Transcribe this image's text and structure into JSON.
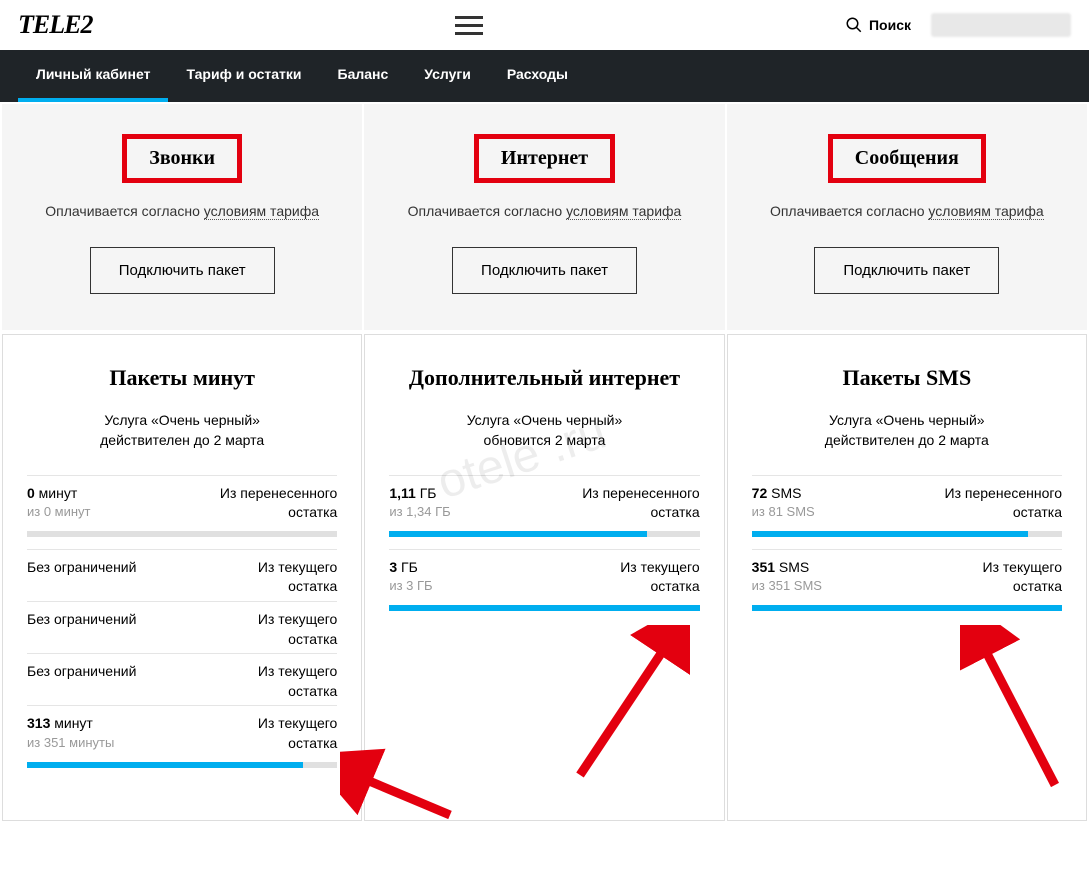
{
  "header": {
    "logo": "TELE2",
    "search_label": "Поиск"
  },
  "nav": {
    "items": [
      "Личный кабинет",
      "Тариф и остатки",
      "Баланс",
      "Услуги",
      "Расходы"
    ]
  },
  "top_cards": [
    {
      "title": "Звонки",
      "sub_prefix": "Оплачивается согласно ",
      "sub_link": "условиям тарифа",
      "button": "Подключить пакет"
    },
    {
      "title": "Интернет",
      "sub_prefix": "Оплачивается согласно ",
      "sub_link": "условиям тарифа",
      "button": "Подключить пакет"
    },
    {
      "title": "Сообщения",
      "sub_prefix": "Оплачивается согласно ",
      "sub_link": "условиям тарифа",
      "button": "Подключить пакет"
    }
  ],
  "bottom_cards": [
    {
      "title": "Пакеты минут",
      "service_line1": "Услуга «Очень черный»",
      "service_line2": "действителен до 2 марта",
      "rows": [
        {
          "left_v1_b": "0",
          "left_v1_u": "минут",
          "left_v2": "из 0 минут",
          "right1": "Из перенесенного",
          "right2": "остатка",
          "bar": 0
        },
        {
          "left_plain": "Без ограничений",
          "right1": "Из текущего",
          "right2": "остатка"
        },
        {
          "left_plain": "Без ограничений",
          "right1": "Из текущего",
          "right2": "остатка"
        },
        {
          "left_plain": "Без ограничений",
          "right1": "Из текущего",
          "right2": "остатка"
        },
        {
          "left_v1_b": "313",
          "left_v1_u": "минут",
          "left_v2": "из 351 минуты",
          "right1": "Из текущего",
          "right2": "остатка",
          "bar": 89
        }
      ]
    },
    {
      "title": "Дополнительный интернет",
      "service_line1": "Услуга «Очень черный»",
      "service_line2": "обновится 2 марта",
      "rows": [
        {
          "left_v1_b": "1,11",
          "left_v1_u": "ГБ",
          "left_v2": "из 1,34 ГБ",
          "right1": "Из перенесенного",
          "right2": "остатка",
          "bar": 83
        },
        {
          "left_v1_b": "3",
          "left_v1_u": "ГБ",
          "left_v2": "из 3 ГБ",
          "right1": "Из текущего",
          "right2": "остатка",
          "bar": 100
        }
      ]
    },
    {
      "title": "Пакеты SMS",
      "service_line1": "Услуга «Очень черный»",
      "service_line2": "действителен до 2 марта",
      "rows": [
        {
          "left_v1_b": "72",
          "left_v1_u": "SMS",
          "left_v2": "из 81 SMS",
          "right1": "Из перенесенного",
          "right2": "остатка",
          "bar": 89
        },
        {
          "left_v1_b": "351",
          "left_v1_u": "SMS",
          "left_v2": "из 351 SMS",
          "right1": "Из текущего",
          "right2": "остатка",
          "bar": 100
        }
      ]
    }
  ],
  "watermark": "otele .ru"
}
